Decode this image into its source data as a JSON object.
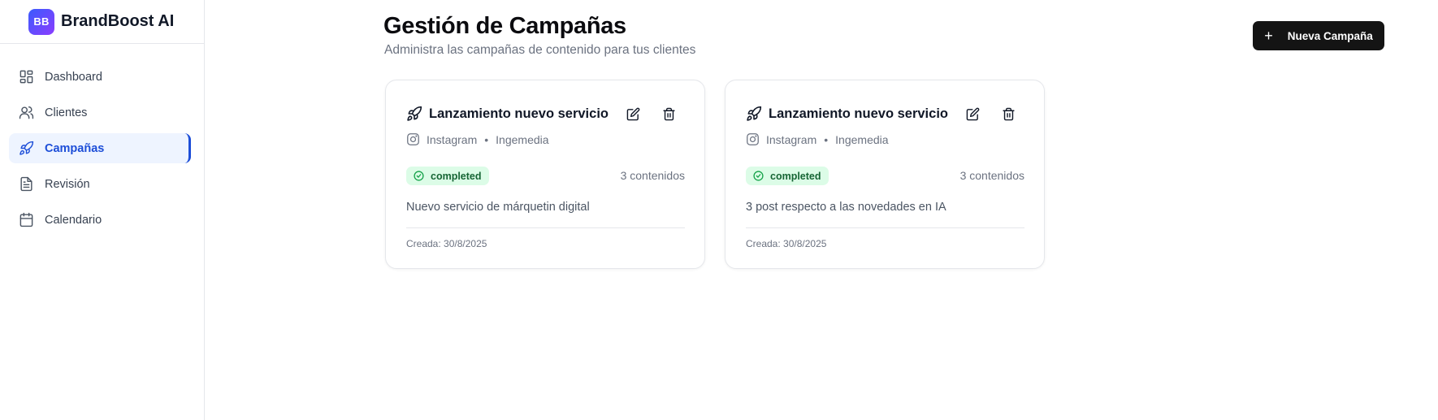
{
  "brand": {
    "logo_text": "BB",
    "name": "BrandBoost AI",
    "logo_colors": [
      "#3b5bfd",
      "#8b3dff"
    ]
  },
  "sidebar": {
    "items": [
      {
        "label": "Dashboard",
        "icon": "layout-dashboard-icon",
        "active": false
      },
      {
        "label": "Clientes",
        "icon": "users-icon",
        "active": false
      },
      {
        "label": "Campañas",
        "icon": "rocket-icon",
        "active": true
      },
      {
        "label": "Revisión",
        "icon": "file-text-icon",
        "active": false
      },
      {
        "label": "Calendario",
        "icon": "calendar-icon",
        "active": false
      }
    ]
  },
  "header": {
    "title": "Gestión de Campañas",
    "subtitle": "Administra las campañas de contenido para tus clientes",
    "new_button_label": "Nueva Campaña"
  },
  "campaigns": [
    {
      "title": "Lanzamiento nuevo servicio",
      "platform": "Instagram",
      "separator": "•",
      "client": "Ingemedia",
      "status": "completed",
      "content_count": "3 contenidos",
      "description": "Nuevo servicio de márquetin digital",
      "created": "Creada: 30/8/2025"
    },
    {
      "title": "Lanzamiento nuevo servicio",
      "platform": "Instagram",
      "separator": "•",
      "client": "Ingemedia",
      "status": "completed",
      "content_count": "3 contenidos",
      "description": "3 post respecto a las novedades en IA",
      "created": "Creada: 30/8/2025"
    }
  ],
  "colors": {
    "accent": "#1d4ed8",
    "active_bg": "#eef4ff",
    "primary_button": "#141414",
    "status_completed_bg": "#dcfce7",
    "status_completed_text": "#166534"
  }
}
